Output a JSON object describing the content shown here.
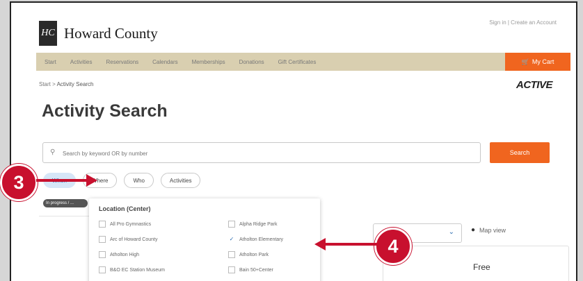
{
  "site": {
    "logo_mark": "HC",
    "name": "Howard County",
    "account_links": "Sign in | Create an Account"
  },
  "nav": {
    "items": [
      "Start",
      "Activities",
      "Reservations",
      "Calendars",
      "Memberships",
      "Donations",
      "Gift Certificates"
    ],
    "cart": "My Cart",
    "cart_icon": "cart-icon"
  },
  "breadcrumb": {
    "start": "Start",
    "sep": ">",
    "current": "Activity Search"
  },
  "brand": {
    "active_logo": "ACTIVE"
  },
  "page": {
    "title": "Activity Search"
  },
  "search": {
    "placeholder": "Search by keyword OR by number",
    "button": "Search"
  },
  "filters": {
    "chips": [
      "When",
      "Where",
      "Who",
      "Activities"
    ],
    "selected": "When",
    "in_progress": "In progress / ..."
  },
  "location_dropdown": {
    "title": "Location (Center)",
    "left_column": [
      "All Pro Gymnastics",
      "Arc of Howard County",
      "Atholton High",
      "B&O EC Station Museum"
    ],
    "right_column": [
      "Alpha Ridge Park",
      "Atholton Elementary",
      "Atholton Park",
      "Bain 50+Center"
    ],
    "checked": "Atholton Elementary"
  },
  "results": {
    "map_view": "Map view",
    "price": "Free"
  },
  "annotations": {
    "callout_3": "3",
    "callout_4": "4",
    "color": "#c8102e"
  }
}
